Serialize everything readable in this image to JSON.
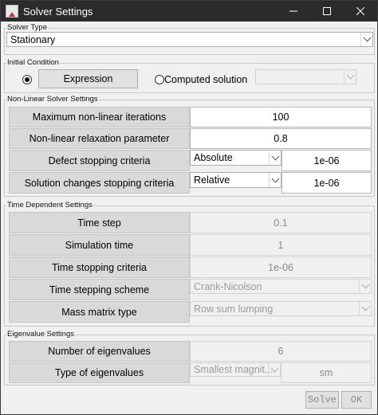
{
  "window": {
    "title": "Solver Settings"
  },
  "solver_type": {
    "group_label": "Solver Type",
    "selected": "Stationary"
  },
  "initial_condition": {
    "group_label": "Initial Condition",
    "expression_label": "Expression",
    "computed_label": "Computed solution",
    "computed_dropdown_value": ""
  },
  "nonlinear": {
    "group_label": "Non-Linear Solver Settings",
    "max_iter_label": "Maximum non-linear iterations",
    "max_iter_value": "100",
    "relax_label": "Non-linear relaxation parameter",
    "relax_value": "0.8",
    "defect_label": "Defect stopping criteria",
    "defect_mode": "Absolute",
    "defect_value": "1e-06",
    "changes_label": "Solution changes stopping criteria",
    "changes_mode": "Relative",
    "changes_value": "1e-06"
  },
  "time_dependent": {
    "group_label": "Time Dependent Settings",
    "time_step_label": "Time step",
    "time_step_value": "0.1",
    "sim_time_label": "Simulation time",
    "sim_time_value": "1",
    "time_stop_label": "Time stopping criteria",
    "time_stop_value": "1e-06",
    "scheme_label": "Time stepping scheme",
    "scheme_value": "Crank-Nicolson",
    "mass_label": "Mass matrix type",
    "mass_value": "Row sum lumping"
  },
  "eigenvalue": {
    "group_label": "Eigenvalue Settings",
    "count_label": "Number of eigenvalues",
    "count_value": "6",
    "type_label": "Type of eigenvalues",
    "type_value": "Smallest magnit...",
    "type_code": "sm"
  },
  "footer": {
    "solve_label": "Solve",
    "ok_label": "OK"
  }
}
